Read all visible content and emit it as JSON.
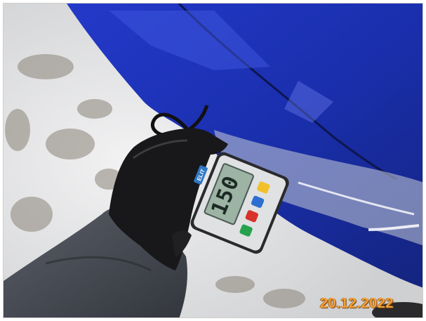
{
  "photo": {
    "date_stamp": "20.12.2022",
    "gauge": {
      "display_value": "150",
      "brand_label": "ELIT"
    },
    "colors": {
      "car_paint": "#1f36b8",
      "snow": "#e9e9ea",
      "glove": "#1b1b1d",
      "sleeve": "#4a4d55",
      "gauge_body": "#2a2a2d",
      "date_stamp": "#f0a23a"
    }
  }
}
